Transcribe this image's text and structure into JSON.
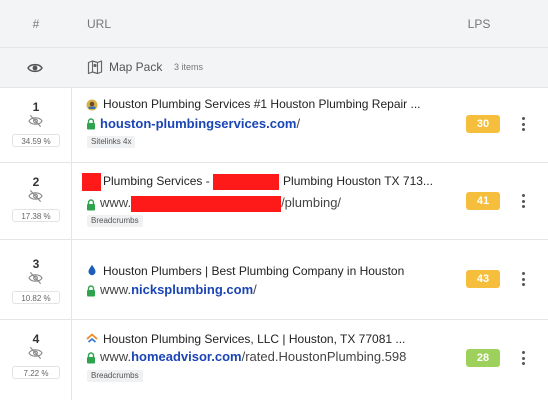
{
  "header": {
    "num": "#",
    "url": "URL",
    "lps": "LPS"
  },
  "map_pack": {
    "icon": "eye-icon",
    "map_icon": "map-icon",
    "label": "Map Pack",
    "count": "3 items"
  },
  "colors": {
    "orange": "#f5be3c",
    "green": "#9dd15b",
    "link": "#1a45b5",
    "lock": "#2ea44f",
    "redact": "#ff1a1a"
  },
  "rows": [
    {
      "rank": "1",
      "pct": "34.59 %",
      "favicon": "plumber-favicon",
      "title": "Houston Plumbing Services #1 Houston Plumbing Repair ...",
      "url_prefix": "",
      "host": "houston-plumbingservices.com",
      "path": "/",
      "tag": "Sitelinks 4x",
      "lps": "30",
      "lps_color": "#f5be3c"
    },
    {
      "rank": "2",
      "pct": "17.38 %",
      "favicon": "",
      "title_a": "Plumbing Services - ",
      "title_b": "Plumbing Houston TX 713...",
      "url_prefix": "www.",
      "host": "",
      "path": "/plumbing/",
      "tag": "Breadcrumbs",
      "lps": "41",
      "lps_color": "#f5be3c"
    },
    {
      "rank": "3",
      "pct": "10.82 %",
      "favicon": "water-drop-favicon",
      "title": "Houston Plumbers | Best Plumbing Company in Houston",
      "url_prefix": "www.",
      "host": "nicksplumbing.com",
      "path": "/",
      "tag": "",
      "lps": "43",
      "lps_color": "#f5be3c"
    },
    {
      "rank": "4",
      "pct": "7.22 %",
      "favicon": "homeadvisor-favicon",
      "title": "Houston Plumbing Services, LLC | Houston, TX 77081 ...",
      "url_prefix": "www.",
      "host": "homeadvisor.com",
      "path": "/rated.HoustonPlumbing.598",
      "tag": "Breadcrumbs",
      "lps": "28",
      "lps_color": "#9dd15b"
    }
  ]
}
